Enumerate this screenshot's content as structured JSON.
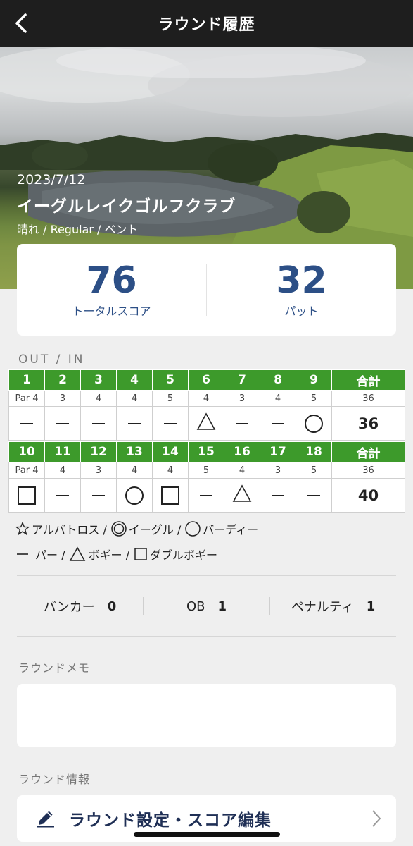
{
  "header": {
    "title": "ラウンド履歴",
    "back_icon": "chevron-left-icon"
  },
  "hero": {
    "date": "2023/7/12",
    "course": "イーグルレイクゴルフクラブ",
    "conditions": "晴れ / Regular  / ベント"
  },
  "summary": {
    "total_score": "76",
    "total_score_label": "トータルスコア",
    "putts": "32",
    "putts_label": "パット"
  },
  "scorecard": {
    "section_label": "OUT / IN",
    "total_header": "合計",
    "out": {
      "holes": [
        "1",
        "2",
        "3",
        "4",
        "5",
        "6",
        "7",
        "8",
        "9"
      ],
      "pars": [
        "Par 4",
        "3",
        "4",
        "4",
        "5",
        "4",
        "3",
        "4",
        "5"
      ],
      "par_total": "36",
      "results": [
        "par",
        "par",
        "par",
        "par",
        "par",
        "bogey",
        "par",
        "par",
        "birdie"
      ],
      "score_total": "36"
    },
    "in": {
      "holes": [
        "10",
        "11",
        "12",
        "13",
        "14",
        "15",
        "16",
        "17",
        "18"
      ],
      "pars": [
        "Par 4",
        "4",
        "3",
        "4",
        "4",
        "5",
        "4",
        "3",
        "5"
      ],
      "par_total": "36",
      "results": [
        "double-bogey",
        "par",
        "par",
        "birdie",
        "double-bogey",
        "par",
        "bogey",
        "par",
        "par"
      ],
      "score_total": "40"
    }
  },
  "legend": {
    "albatross": "アルバトロス /",
    "eagle": "イーグル /",
    "birdie": "バーディー",
    "par": "パー /",
    "bogey": "ボギー /",
    "double_bogey": "ダブルボギー"
  },
  "stats": {
    "bunker_label": "バンカー",
    "bunker_value": "0",
    "ob_label": "OB",
    "ob_value": "1",
    "penalty_label": "ペナルティ",
    "penalty_value": "1"
  },
  "memo": {
    "label": "ラウンドメモ",
    "text": ""
  },
  "info": {
    "label": "ラウンド情報"
  },
  "edit_button": {
    "label": "ラウンド設定・スコア編集"
  },
  "colors": {
    "header_bg": "#1e1e1e",
    "accent_blue": "#2c4f86",
    "hole_green": "#3d9a2b"
  }
}
